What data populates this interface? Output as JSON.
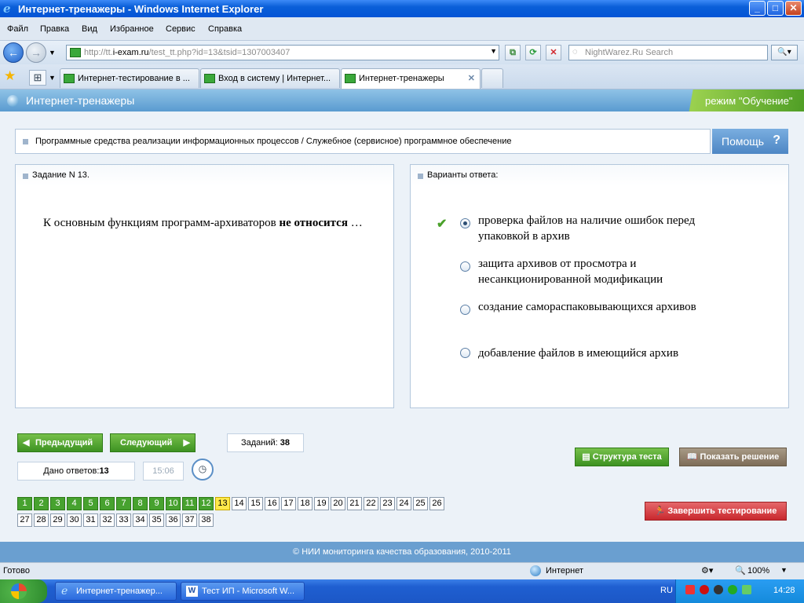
{
  "window": {
    "title": "Интернет-тренажеры - Windows Internet Explorer"
  },
  "menu": [
    "Файл",
    "Правка",
    "Вид",
    "Избранное",
    "Сервис",
    "Справка"
  ],
  "address": {
    "prefix": "http://tt.",
    "host": "i-exam.ru",
    "path": "/test_tt.php?id=13&tsid=1307003407"
  },
  "search": {
    "placeholder": "NightWarez.Ru Search"
  },
  "tabs": [
    {
      "label": "Интернет-тестирование в ...",
      "active": false
    },
    {
      "label": "Вход в систему | Интернет...",
      "active": false
    },
    {
      "label": "Интернет-тренажеры",
      "active": true
    }
  ],
  "app": {
    "title": "Интернет-тренажеры",
    "mode": "режим \"Обучение\"",
    "breadcrumb": "Программные средства реализации информационных процессов / Служебное (сервисное) программное обеспечение",
    "help": "Помощь",
    "task_header": "Задание N 13.",
    "answers_header": "Варианты ответа:",
    "question_plain": "К основным функциям программ-архиваторов ",
    "question_bold": "не относится",
    "question_tail": " …",
    "answers": [
      {
        "text": "проверка файлов на наличие ошибок перед упаковкой в архив",
        "selected": true
      },
      {
        "text": "защита архивов от просмотра и несанкционированной модификации",
        "selected": false
      },
      {
        "text": "создание самораспаковывающихся архивов",
        "selected": false
      },
      {
        "text": "добавление файлов в имеющийся архив",
        "selected": false
      }
    ],
    "prev": "Предыдущий",
    "next": "Следующий",
    "tasks_label": "Заданий:",
    "tasks_count": "38",
    "answered_label": "Дано ответов:",
    "answered_count": "13",
    "timer": "15:06",
    "structure": "Структура теста",
    "show_solution": "Показать решение",
    "finish": "Завершить тестирование",
    "numbers_done": [
      "1",
      "2",
      "3",
      "4",
      "5",
      "6",
      "7",
      "8",
      "9",
      "10",
      "11",
      "12"
    ],
    "number_current": "13",
    "numbers_rest": [
      "14",
      "15",
      "16",
      "17",
      "18",
      "19",
      "20",
      "21",
      "22",
      "23",
      "24",
      "25",
      "26",
      "27",
      "28",
      "29",
      "30",
      "31",
      "32",
      "33",
      "34",
      "35",
      "36",
      "37",
      "38"
    ],
    "footer": "© НИИ мониторинга качества образования, 2010-2011"
  },
  "status": {
    "left": "Готово",
    "zone": "Интернет",
    "zoom": "100%"
  },
  "taskbar": [
    {
      "label": "Интернет-тренажер..."
    },
    {
      "label": "Тест ИП - Microsoft W..."
    }
  ],
  "tray": {
    "lang": "RU",
    "clock": "14:28"
  }
}
